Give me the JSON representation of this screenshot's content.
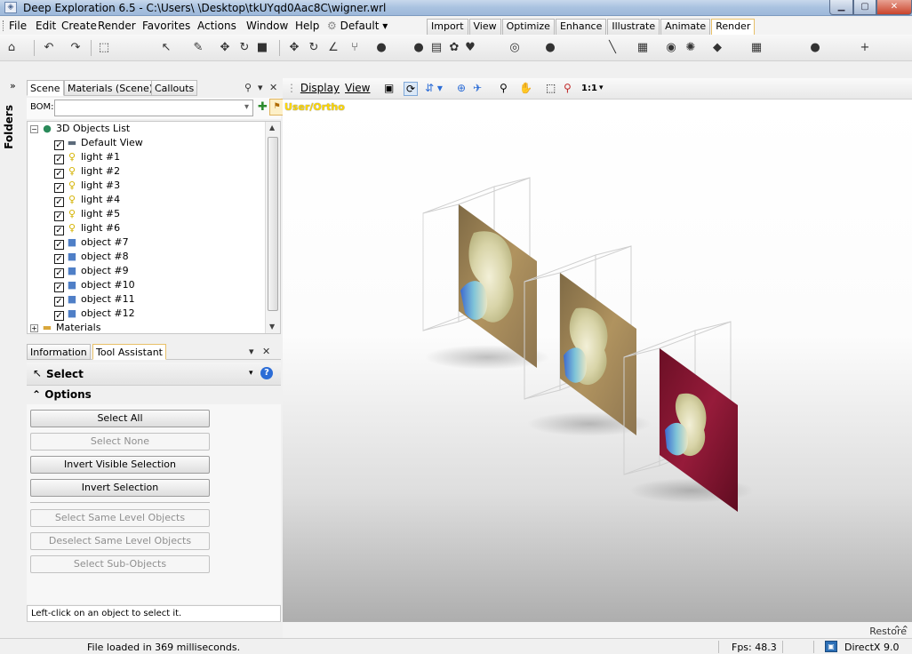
{
  "window": {
    "title": "Deep Exploration 6.5 - C:\\Users\\         \\Desktop\\tkUYqd0Aac8C\\wigner.wrl"
  },
  "menu": {
    "items": [
      {
        "label": "File"
      },
      {
        "label": "Edit"
      },
      {
        "label": "Create"
      },
      {
        "label": "Render"
      },
      {
        "label": "Favorites"
      },
      {
        "label": "Actions"
      },
      {
        "label": "Window"
      },
      {
        "label": "Help"
      }
    ],
    "profile_label": "Default",
    "mode_tabs": [
      "Import",
      "View",
      "Optimize",
      "Enhance",
      "Illustrate",
      "Animate",
      "Render"
    ],
    "active_mode": "Render"
  },
  "left_strip": {
    "label": "Folders"
  },
  "scene_panel": {
    "tabs": [
      "Scene",
      "Materials (Scene)",
      "Callouts"
    ],
    "bom_label": "BOM:",
    "tree": {
      "root": "3D Objects List",
      "items": [
        {
          "label": "Default View",
          "icon": "camera-icon",
          "checked": true
        },
        {
          "label": "light #1",
          "icon": "bulb-icon",
          "checked": true
        },
        {
          "label": "light #2",
          "icon": "bulb-icon",
          "checked": true
        },
        {
          "label": "light #3",
          "icon": "bulb-icon",
          "checked": true
        },
        {
          "label": "light #4",
          "icon": "bulb-icon",
          "checked": true
        },
        {
          "label": "light #5",
          "icon": "bulb-icon",
          "checked": true
        },
        {
          "label": "light #6",
          "icon": "bulb-icon",
          "checked": true
        },
        {
          "label": "object #7",
          "icon": "cube-icon",
          "checked": true
        },
        {
          "label": "object #8",
          "icon": "cube-icon",
          "checked": true
        },
        {
          "label": "object #9",
          "icon": "cube-icon",
          "checked": true
        },
        {
          "label": "object #10",
          "icon": "cube-icon",
          "checked": true
        },
        {
          "label": "object #11",
          "icon": "cube-icon",
          "checked": true
        },
        {
          "label": "object #12",
          "icon": "cube-icon",
          "checked": true
        }
      ],
      "materials": "Materials"
    }
  },
  "tool_panel": {
    "tabs": [
      "Information",
      "Tool Assistant"
    ],
    "active_tab": "Tool Assistant",
    "tool_name": "Select",
    "options_label": "Options",
    "buttons": [
      {
        "label": "Select All",
        "enabled": true
      },
      {
        "label": "Select None",
        "enabled": false
      },
      {
        "label": "Invert Visible Selection",
        "enabled": true
      },
      {
        "label": "Invert Selection",
        "enabled": true
      },
      {
        "label": "Select Same Level Objects",
        "enabled": false
      },
      {
        "label": "Deselect Same Level Objects",
        "enabled": false
      },
      {
        "label": "Select Sub-Objects",
        "enabled": false
      }
    ],
    "hint": "Left-click on an object to select it."
  },
  "viewport": {
    "toolbar": {
      "display_label": "Display",
      "view_label": "View",
      "zoom_label": "1:1"
    },
    "camera_label": "User/Ortho",
    "colors": {
      "camera_label": "#ffd800",
      "panel_tan": "#a8875a",
      "panel_maroon": "#7e1430"
    }
  },
  "restore_label": "Restore",
  "status": {
    "message": "File loaded in 369 milliseconds.",
    "fps": "Fps: 48.3",
    "renderer": "DirectX 9.0"
  }
}
